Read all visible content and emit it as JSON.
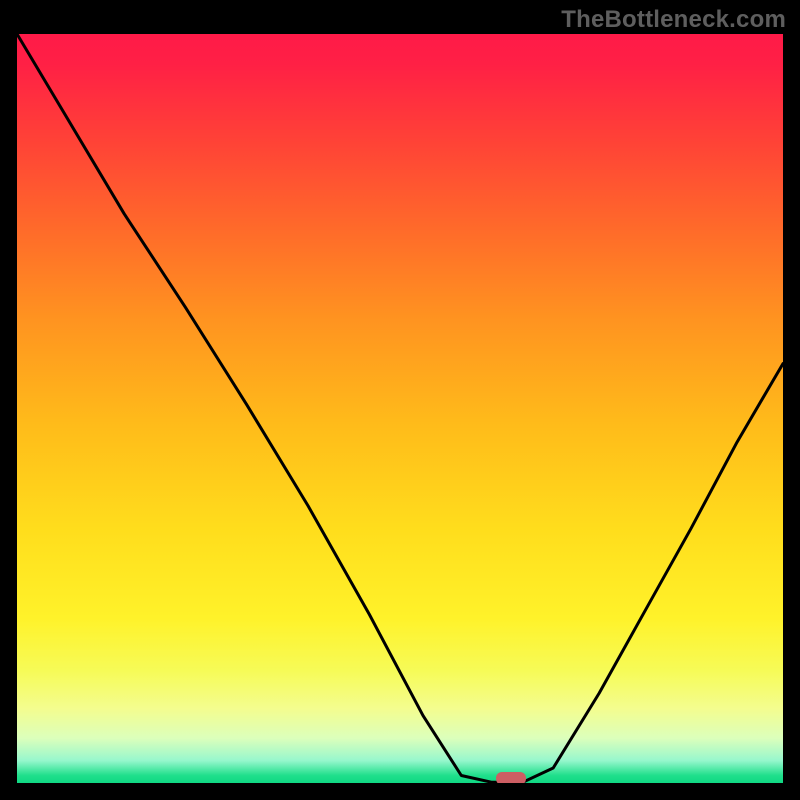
{
  "watermark": "TheBottleneck.com",
  "colors": {
    "background": "#000000",
    "curve": "#000000",
    "marker": "#cd5e63"
  },
  "chart_data": {
    "type": "line",
    "title": "",
    "xlabel": "",
    "ylabel": "",
    "ylim": [
      0,
      100
    ],
    "gradient_stops": [
      {
        "pct": 0,
        "color": "#ff1a48"
      },
      {
        "pct": 14,
        "color": "#ff4137"
      },
      {
        "pct": 26,
        "color": "#ff6a2a"
      },
      {
        "pct": 38,
        "color": "#ff9320"
      },
      {
        "pct": 52,
        "color": "#ffbb1a"
      },
      {
        "pct": 66,
        "color": "#ffdd1c"
      },
      {
        "pct": 78,
        "color": "#fff22a"
      },
      {
        "pct": 90,
        "color": "#f4fd8e"
      },
      {
        "pct": 97,
        "color": "#97f7cd"
      },
      {
        "pct": 100,
        "color": "#10d884"
      }
    ],
    "series": [
      {
        "name": "bottleneck-curve",
        "points": [
          {
            "x": 0.0,
            "y": 100.0
          },
          {
            "x": 0.07,
            "y": 88.0
          },
          {
            "x": 0.14,
            "y": 76.0
          },
          {
            "x": 0.22,
            "y": 63.5
          },
          {
            "x": 0.3,
            "y": 50.5
          },
          {
            "x": 0.38,
            "y": 37.0
          },
          {
            "x": 0.46,
            "y": 22.5
          },
          {
            "x": 0.53,
            "y": 9.0
          },
          {
            "x": 0.58,
            "y": 1.0
          },
          {
            "x": 0.62,
            "y": 0.1
          },
          {
            "x": 0.66,
            "y": 0.1
          },
          {
            "x": 0.7,
            "y": 2.0
          },
          {
            "x": 0.76,
            "y": 12.0
          },
          {
            "x": 0.82,
            "y": 23.0
          },
          {
            "x": 0.88,
            "y": 34.0
          },
          {
            "x": 0.94,
            "y": 45.5
          },
          {
            "x": 1.0,
            "y": 56.0
          }
        ]
      }
    ],
    "marker": {
      "x": 0.645,
      "y": 0.0
    }
  }
}
